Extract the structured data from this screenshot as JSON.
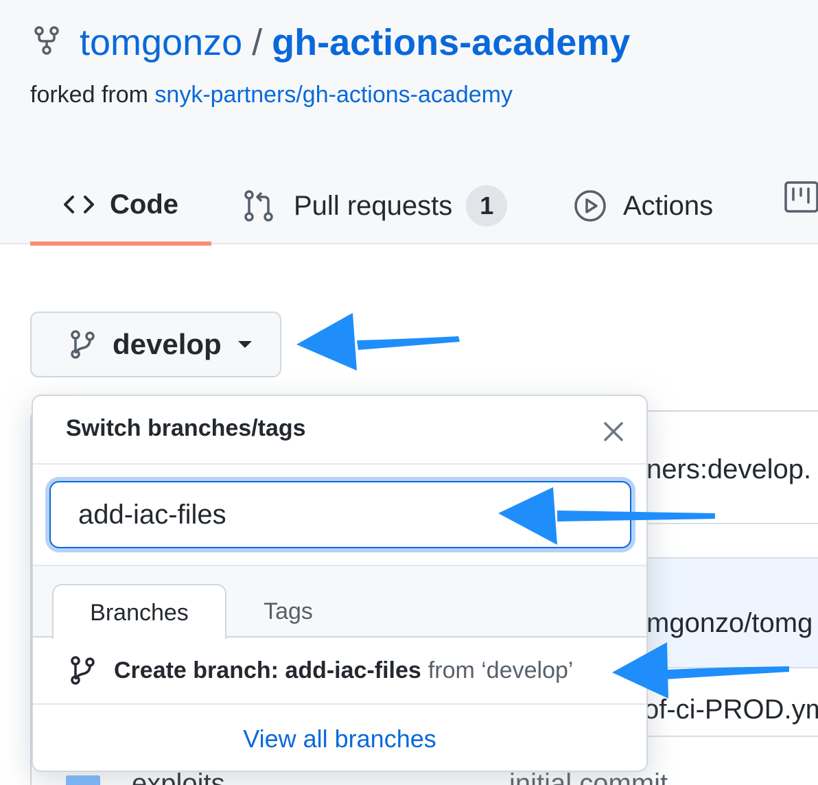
{
  "repo": {
    "owner": "tomgonzo",
    "separator": "/",
    "name": "gh-actions-academy",
    "forked_prefix": "forked from",
    "forked_source": "snyk-partners/gh-actions-academy"
  },
  "tabs": [
    {
      "label": "Code",
      "icon": "code-icon",
      "selected": true
    },
    {
      "label": "Pull requests",
      "icon": "git-pull-request-icon",
      "counter": "1"
    },
    {
      "label": "Actions",
      "icon": "play-icon"
    },
    {
      "label": "",
      "icon": "project-icon"
    }
  ],
  "branch_button": {
    "label": "develop",
    "icon": "git-branch-icon"
  },
  "dropdown": {
    "title": "Switch branches/tags",
    "filter_value": "add-iac-files",
    "tabs": [
      {
        "label": "Branches",
        "selected": true
      },
      {
        "label": "Tags"
      }
    ],
    "create_prefix": "Create branch: add-iac-files",
    "create_suffix": "from ‘develop’",
    "view_all": "View all branches"
  },
  "background_rows": {
    "row1": "ners:develop.",
    "row3": "mgonzo/tomg",
    "row4": "of-ci-PROD.ym",
    "row5_name": "exploits",
    "row5_commit": "initial commit"
  },
  "colors": {
    "link": "#0969da",
    "tab_underline": "#fd8c73",
    "arrow": "#1f8efa"
  }
}
